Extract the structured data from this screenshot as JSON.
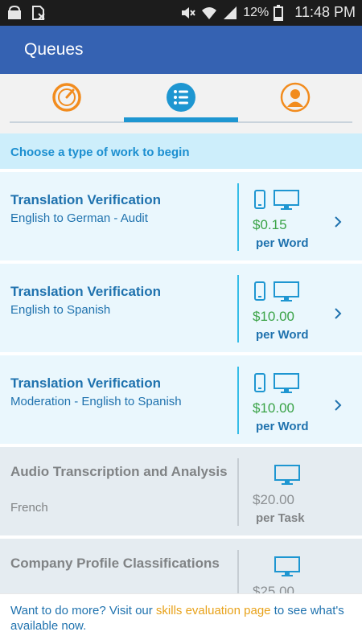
{
  "status_bar": {
    "battery_percent": "12%",
    "time": "11:48 PM"
  },
  "app_bar": {
    "title": "Queues"
  },
  "tabs": [
    {
      "icon": "speedometer-icon",
      "active": false
    },
    {
      "icon": "list-icon",
      "active": true
    },
    {
      "icon": "profile-icon",
      "active": false
    }
  ],
  "header": {
    "text": "Choose a type of work to begin"
  },
  "queues": [
    {
      "title": "Translation Verification",
      "subtitle": "English to German - Audit",
      "price": "$0.15",
      "unit": "per Word",
      "devices": [
        "phone-icon",
        "monitor-icon"
      ],
      "enabled": true
    },
    {
      "title": "Translation Verification",
      "subtitle": "English to Spanish",
      "price": "$10.00",
      "unit": "per Word",
      "devices": [
        "phone-icon",
        "monitor-icon"
      ],
      "enabled": true
    },
    {
      "title": "Translation Verification",
      "subtitle": "Moderation - English to Spanish",
      "price": "$10.00",
      "unit": "per Word",
      "devices": [
        "phone-icon",
        "monitor-icon"
      ],
      "enabled": true
    },
    {
      "title": "Audio Transcription and Analysis",
      "subtitle": "French",
      "price": "$20.00",
      "unit": "per Task",
      "devices": [
        "monitor-icon"
      ],
      "enabled": false
    },
    {
      "title": "Company Profile Classifications",
      "subtitle": "",
      "price": "$25.00",
      "unit": "",
      "devices": [
        "monitor-icon"
      ],
      "enabled": false
    }
  ],
  "footer": {
    "prefix": "Want to do more? Visit our ",
    "link": "skills evaluation page",
    "suffix": " to see what's available now."
  },
  "colors": {
    "app_bar": "#3562b2",
    "accent_blue": "#1e96d1",
    "orange": "#f28c1e",
    "price_green": "#3aa347",
    "link_orange": "#e8a21a"
  }
}
